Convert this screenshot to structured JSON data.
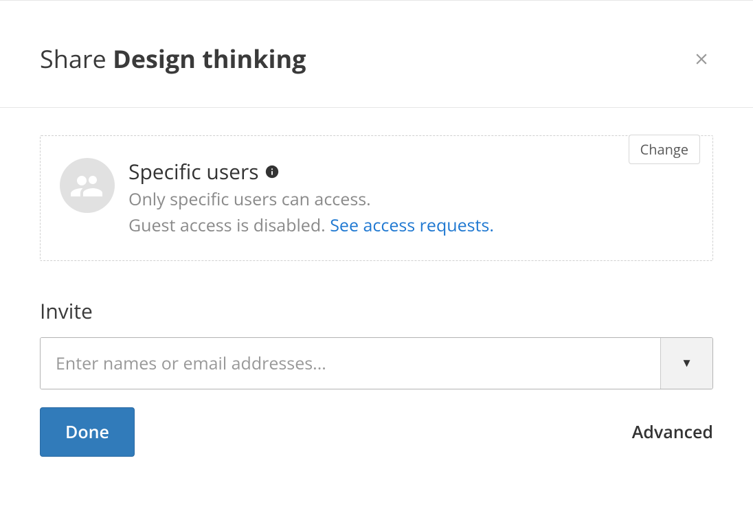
{
  "header": {
    "title_prefix": "Share ",
    "title_bold": "Design thinking"
  },
  "access": {
    "change_label": "Change",
    "title": "Specific users",
    "desc_line1": "Only specific users can access.",
    "desc_line2_prefix": "Guest access is disabled. ",
    "desc_link": "See access requests."
  },
  "invite": {
    "label": "Invite",
    "placeholder": "Enter names or email addresses..."
  },
  "footer": {
    "done_label": "Done",
    "advanced_label": "Advanced"
  }
}
